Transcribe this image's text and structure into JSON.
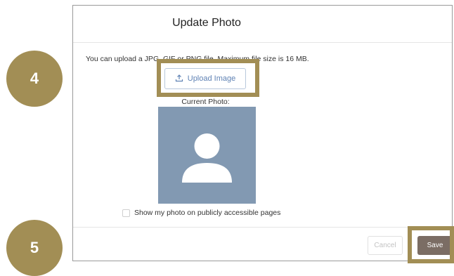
{
  "modal": {
    "title": "Update Photo",
    "info_text": "You can upload a JPG, GIF or PNG file. Maximum file size is 16 MB.",
    "upload_button_label": "Upload Image",
    "upload_icon": "upload-icon",
    "current_photo_label": "Current Photo:",
    "avatar_icon": "user-silhouette-icon",
    "public_checkbox_label": "Show my photo on publicly accessible pages",
    "public_checkbox_checked": false,
    "cancel_label": "Cancel",
    "save_label": "Save"
  },
  "annotations": {
    "step_upload": "4",
    "step_save": "5"
  },
  "colors": {
    "annotation": "#a28e55",
    "save_button": "#7b6d64",
    "avatar_background": "#8299b2",
    "link_blue": "#5f82b4"
  }
}
